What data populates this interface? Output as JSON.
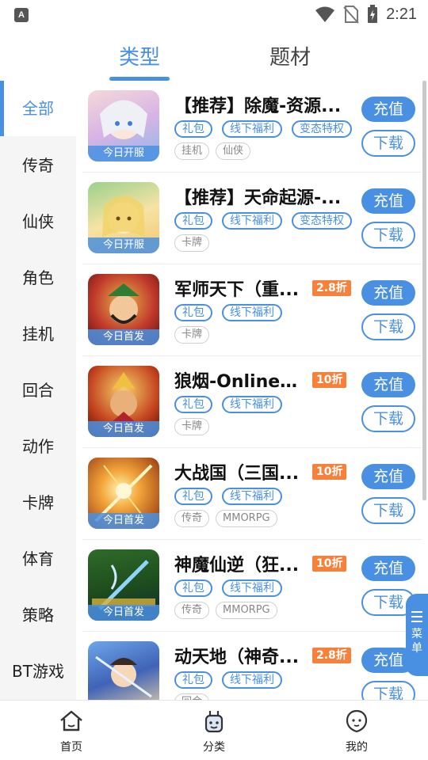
{
  "status_bar": {
    "time": "2:21",
    "left_badge": "A"
  },
  "top_tabs": [
    {
      "label": "类型",
      "active": true
    },
    {
      "label": "题材",
      "active": false
    }
  ],
  "sidebar": {
    "items": [
      {
        "label": "全部",
        "active": true
      },
      {
        "label": "传奇"
      },
      {
        "label": "仙侠"
      },
      {
        "label": "角色"
      },
      {
        "label": "挂机"
      },
      {
        "label": "回合"
      },
      {
        "label": "动作"
      },
      {
        "label": "卡牌"
      },
      {
        "label": "体育"
      },
      {
        "label": "策略"
      },
      {
        "label": "BT游戏"
      }
    ]
  },
  "games": [
    {
      "title": "【推荐】除魔-资源...",
      "badge": "今日开服",
      "discount": "",
      "tags": [
        "礼包",
        "线下福利",
        "变态特权"
      ],
      "categories": [
        "挂机",
        "仙侠"
      ],
      "charge": "充值",
      "download": "下载",
      "thumb_colors": [
        "#f4d9d9",
        "#c9a7d6"
      ]
    },
    {
      "title": "【推荐】天命起源-...",
      "badge": "今日开服",
      "discount": "",
      "tags": [
        "礼包",
        "线下福利",
        "变态特权"
      ],
      "categories": [
        "卡牌"
      ],
      "charge": "充值",
      "download": "下载",
      "thumb_colors": [
        "#f6e3a5",
        "#9ad18b"
      ]
    },
    {
      "title": "军师天下（重...",
      "badge": "今日首发",
      "discount": "2.8折",
      "tags": [
        "礼包",
        "线下福利"
      ],
      "categories": [
        "卡牌"
      ],
      "charge": "充值",
      "download": "下载",
      "thumb_colors": [
        "#b3221f",
        "#e8b64c"
      ]
    },
    {
      "title": "狼烟-Online（...",
      "badge": "今日首发",
      "discount": "10折",
      "tags": [
        "礼包",
        "线下福利"
      ],
      "categories": [
        "卡牌"
      ],
      "charge": "充值",
      "download": "下载",
      "thumb_colors": [
        "#7a1d12",
        "#f0c040"
      ]
    },
    {
      "title": "大战国（三国...",
      "badge": "今日首发",
      "discount": "10折",
      "tags": [
        "礼包",
        "线下福利"
      ],
      "categories": [
        "传奇",
        "MMORPG"
      ],
      "charge": "充值",
      "download": "下载",
      "thumb_colors": [
        "#6b2a0f",
        "#f3c548"
      ]
    },
    {
      "title": "神魔仙逆（狂...",
      "badge": "今日首发",
      "discount": "10折",
      "tags": [
        "礼包",
        "线下福利"
      ],
      "categories": [
        "传奇",
        "MMORPG"
      ],
      "charge": "充值",
      "download": "下载",
      "thumb_colors": [
        "#1d4b1d",
        "#6fb3e0"
      ]
    },
    {
      "title": "动天地（神奇...",
      "badge": "",
      "discount": "2.8折",
      "tags": [
        "礼包",
        "线下福利"
      ],
      "categories": [
        "回合"
      ],
      "charge": "充值",
      "download": "下载",
      "thumb_colors": [
        "#3f63b8",
        "#e9d3a6"
      ]
    }
  ],
  "float_menu": {
    "label": "菜单"
  },
  "bottom_nav": [
    {
      "label": "首页",
      "icon": "home-icon"
    },
    {
      "label": "分类",
      "icon": "category-icon"
    },
    {
      "label": "我的",
      "icon": "profile-icon"
    }
  ],
  "colors": {
    "accent": "#4a90e2",
    "discount": "#f7813a"
  }
}
